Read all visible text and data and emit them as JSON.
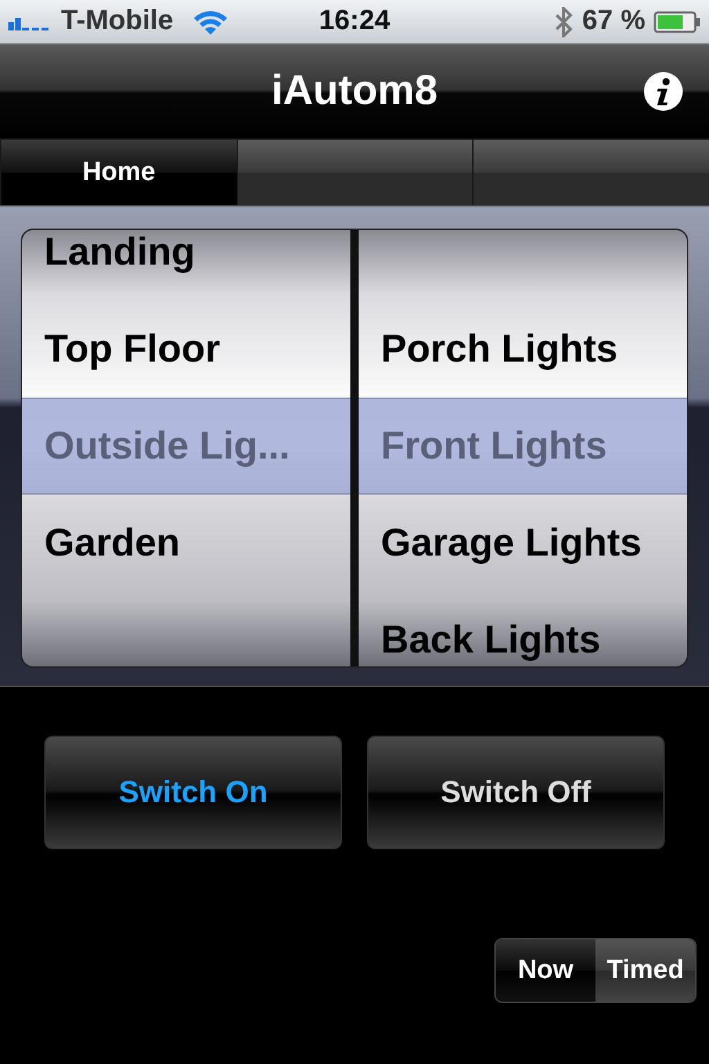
{
  "status_bar": {
    "carrier": "T-Mobile",
    "time": "16:24",
    "battery": "67 %"
  },
  "nav_bar": {
    "title": "iAutom8"
  },
  "tabs": [
    {
      "label": "Home",
      "selected": true
    },
    {
      "selected": false
    },
    {
      "selected": false
    }
  ],
  "picker": {
    "columns": [
      {
        "rows": [
          {
            "label": "Landing",
            "selected": false
          },
          {
            "label": "Top Floor",
            "selected": false
          },
          {
            "label": "Outside Lig...",
            "selected": true
          },
          {
            "label": "Garden",
            "selected": false
          }
        ]
      },
      {
        "rows": [
          {
            "label": "Porch Lights",
            "selected": false
          },
          {
            "label": "Front Lights",
            "selected": true
          },
          {
            "label": "Garage Lights",
            "selected": false
          },
          {
            "label": "Back Lights",
            "selected": false
          }
        ]
      }
    ]
  },
  "buttons": [
    {
      "label": "Switch On",
      "active": true
    },
    {
      "label": "Switch Off",
      "active": false
    }
  ],
  "timing": [
    {
      "label": "Now",
      "selected": true
    },
    {
      "label": "Timed",
      "selected": false
    }
  ]
}
